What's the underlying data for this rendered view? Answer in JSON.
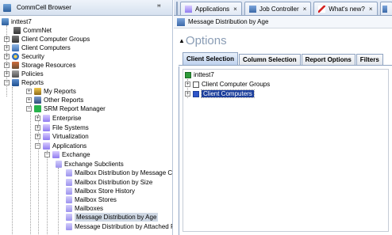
{
  "left_pane": {
    "title": "CommCell Browser",
    "pin_icon": "\u0014",
    "tree": [
      {
        "label": "inttest7",
        "icon": "server-icon"
      },
      {
        "label": "CommNet",
        "icon": "network-icon"
      },
      {
        "label": "Client Computer Groups",
        "icon": "group-icon"
      },
      {
        "label": "Client Computers",
        "icon": "computers-icon"
      },
      {
        "label": "Security",
        "icon": "security-icon"
      },
      {
        "label": "Storage Resources",
        "icon": "storage-icon"
      },
      {
        "label": "Policies",
        "icon": "policies-icon"
      },
      {
        "label": "Reports",
        "icon": "reports-icon"
      },
      {
        "label": "My Reports",
        "icon": "my-reports-icon"
      },
      {
        "label": "Other Reports",
        "icon": "other-reports-icon"
      },
      {
        "label": "SRM Report Manager",
        "icon": "srm-icon"
      },
      {
        "label": "Enterprise",
        "icon": "folder-icon"
      },
      {
        "label": "File Systems",
        "icon": "folder-icon"
      },
      {
        "label": "Virtualization",
        "icon": "folder-icon"
      },
      {
        "label": "Applications",
        "icon": "folder-icon"
      },
      {
        "label": "Exchange",
        "icon": "folder-icon"
      },
      {
        "label": "Exchange Subclients",
        "icon": "report-icon"
      },
      {
        "label": "Mailbox Distribution by Message Co",
        "icon": "report-icon"
      },
      {
        "label": "Mailbox Distribution by Size",
        "icon": "report-icon"
      },
      {
        "label": "Mailbox Store History",
        "icon": "report-icon"
      },
      {
        "label": "Mailbox Stores",
        "icon": "report-icon"
      },
      {
        "label": "Mailboxes",
        "icon": "report-icon"
      },
      {
        "label": "Message Distribution by Age",
        "icon": "report-icon",
        "selected": true
      },
      {
        "label": "Message Distribution by Attached F",
        "icon": "report-icon"
      }
    ]
  },
  "tabs": [
    {
      "label": "",
      "icon": "overflow-icon"
    },
    {
      "label": "Applications",
      "icon": "folder-icon",
      "close": "×"
    },
    {
      "label": "Job Controller",
      "icon": "job-controller-icon",
      "close": "×"
    },
    {
      "label": "What's new?",
      "icon": "whats-new-icon",
      "close": "×"
    },
    {
      "label": "",
      "icon": "report-tab-icon"
    }
  ],
  "subtitle": "Message Distribution by Age",
  "options": {
    "arrow": "▲",
    "title": "Options"
  },
  "subtabs": [
    "Client Selection",
    "Column Selection",
    "Report Options",
    "Filters"
  ],
  "selection_tree": [
    {
      "label": "inttest7"
    },
    {
      "label": "Client Computer Groups"
    },
    {
      "label": "Client Computers",
      "selected": true
    }
  ],
  "colors": {
    "accent": "#1c3f9c",
    "srm_green": "#27b34b",
    "options_title": "#8a9db5"
  }
}
